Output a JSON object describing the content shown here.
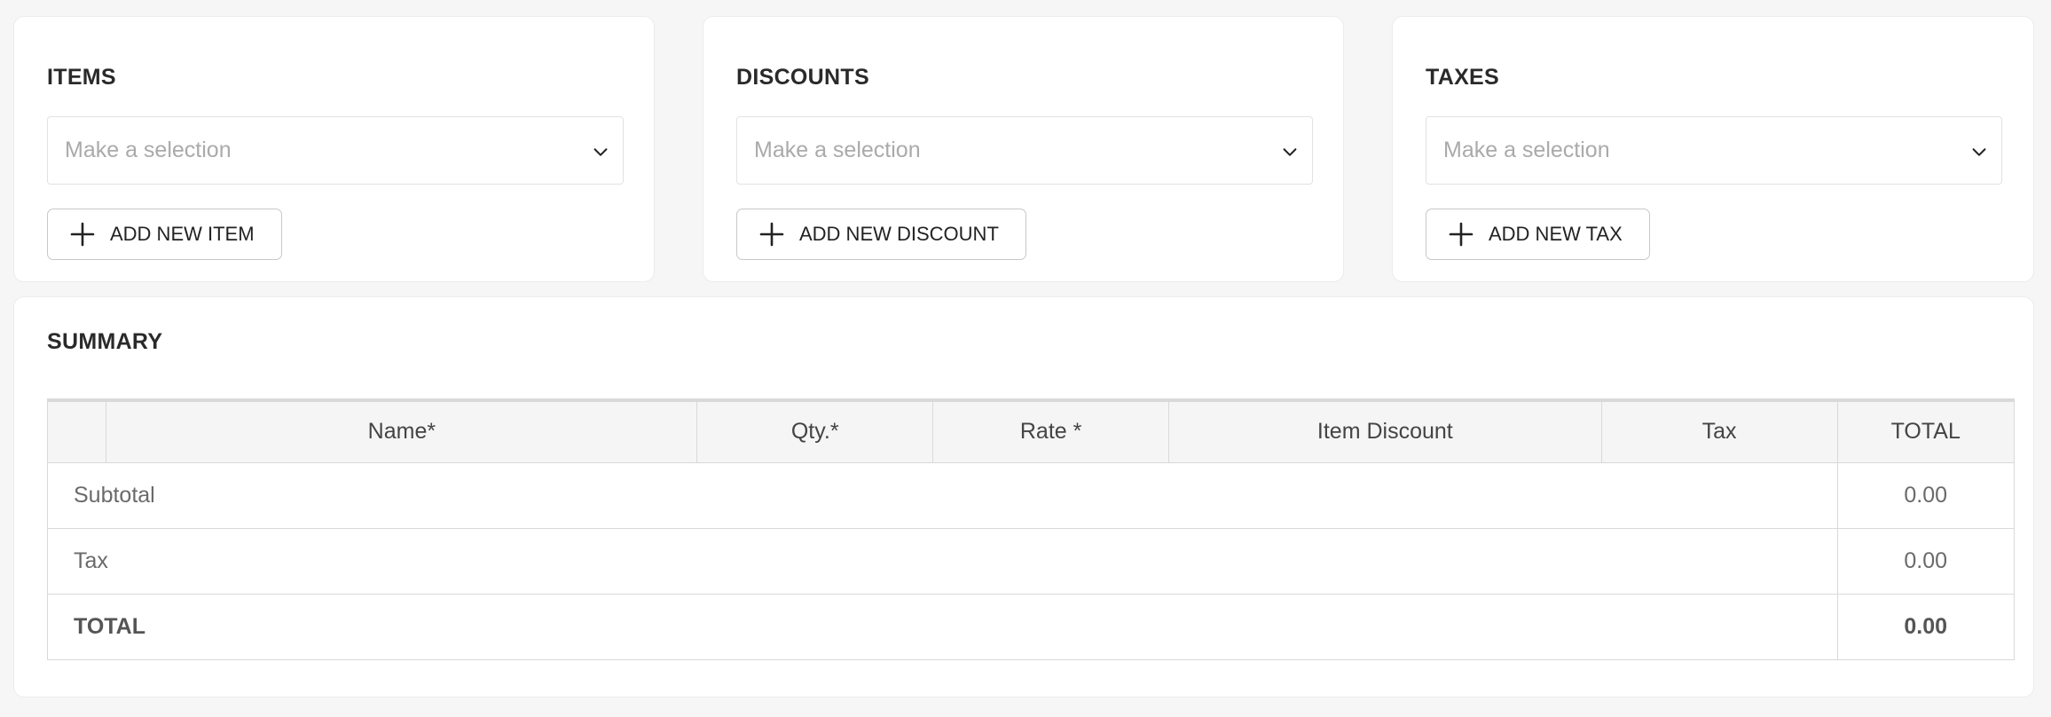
{
  "cards": [
    {
      "title": "ITEMS",
      "placeholder": "Make a selection",
      "button": "ADD NEW ITEM"
    },
    {
      "title": "DISCOUNTS",
      "placeholder": "Make a selection",
      "button": "ADD NEW DISCOUNT"
    },
    {
      "title": "TAXES",
      "placeholder": "Make a selection",
      "button": "ADD NEW TAX"
    }
  ],
  "summary": {
    "title": "SUMMARY",
    "columns": [
      "",
      "Name*",
      "Qty.*",
      "Rate *",
      "Item Discount",
      "Tax",
      "TOTAL"
    ],
    "rows": [
      {
        "label": "Subtotal",
        "value": "0.00"
      },
      {
        "label": "Tax",
        "value": "0.00"
      },
      {
        "label": "TOTAL",
        "value": "0.00"
      }
    ]
  },
  "icons": {
    "dropdown": "chevron-down-icon",
    "add": "plus-icon"
  }
}
